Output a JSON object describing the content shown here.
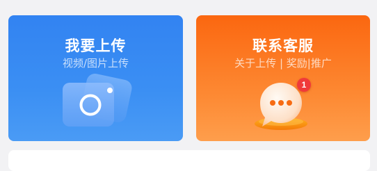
{
  "upload_card": {
    "title": "我要上传",
    "subtitle": "视频/图片上传",
    "icon": "camera-icon",
    "color": "#3283f2"
  },
  "service_card": {
    "title": "联系客服",
    "subtitle": "关于上传 | 奖励|推广",
    "icon": "chat-bubble-icon",
    "badge_count": "1",
    "color": "#fb6710"
  }
}
